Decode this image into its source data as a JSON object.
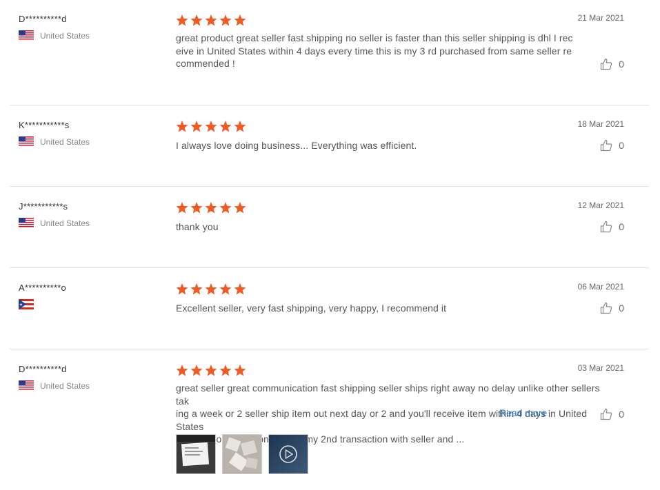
{
  "reviews": [
    {
      "user": "D**********d",
      "country": "United States",
      "flag": "us-flag",
      "rating": 5,
      "date": "21 Mar 2021",
      "text_lines": [
        "great product great seller fast shipping no seller is faster than this seller shipping is dhl I rec",
        "eive in United States within 4 days every time this is my 3 rd  purchased from same seller re",
        "commended !"
      ],
      "likes": "0"
    },
    {
      "user": "K***********s",
      "country": "United States",
      "flag": "us-flag",
      "rating": 5,
      "date": "18 Mar 2021",
      "text_lines": [
        "I always love doing business... Everything was efficient."
      ],
      "likes": "0"
    },
    {
      "user": "J***********s",
      "country": "United States",
      "flag": "us-flag",
      "rating": 5,
      "date": "12 Mar 2021",
      "text_lines": [
        "thank you"
      ],
      "likes": "0"
    },
    {
      "user": "A**********o",
      "country": "",
      "flag": "puerto-rico-flag",
      "rating": 5,
      "date": "06 Mar 2021",
      "text_lines": [
        "Excellent seller, very fast shipping, very happy, I recommend it"
      ],
      "likes": "0"
    },
    {
      "user": "D**********d",
      "country": "United States",
      "flag": "us-flag",
      "rating": 5,
      "date": "03 Mar 2021",
      "text_lines": [
        "great seller great communication fast shipping seller ships right away no delay unlike other sellers tak",
        "ing a week or 2 seller ship item out next day or 2 and you'll receive item within 4 days in United States",
        "coming from hon Kong this is my 2nd transaction with seller and ..."
      ],
      "read_more": "Read more",
      "likes": "0"
    }
  ],
  "colors": {
    "star": "#f15a22",
    "link": "#2a73c8",
    "separator": "#e0e0e0"
  }
}
